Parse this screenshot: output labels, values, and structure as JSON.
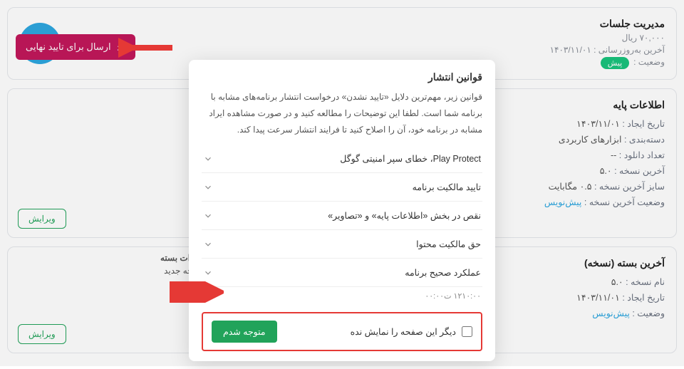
{
  "header": {
    "title": "مدیریت جلسات",
    "price": "۷۰,۰۰۰ ریال",
    "updated_label": "آخرین به‌روزرسانی :",
    "updated_value": "۱۴۰۳/۱۱/۰۱",
    "status_label": "وضعیت :",
    "status_badge": "پیش"
  },
  "submit_label": "ارسال برای تایید نهایی",
  "base_info": {
    "title": "اطلاعات پایه",
    "created_label": "تاریخ ایجاد :",
    "created_value": "۱۴۰۳/۱۱/۰۱",
    "category_label": "دسته‌بندی :",
    "category_value": "ابزارهای کاربردی",
    "downloads_label": "تعداد دانلود :",
    "downloads_value": "--",
    "version_label": "آخرین نسخه :",
    "version_value": "۵.۰",
    "size_label": "سایز آخرین نسخه :",
    "size_value": "۰.۵ مگابایت",
    "vstatus_label": "وضعیت آخرین نسخه :",
    "vstatus_value": "پیش‌نویس",
    "edit": "ویرایش"
  },
  "package": {
    "title": "آخرین بسته (نسخه)",
    "name_label": "نام نسخه :",
    "name_value": "۵.۰",
    "date_label": "تاریخ ایجاد :",
    "date_value": "۱۴۰۳/۱۱/۰۱",
    "status_label": "وضعیت :",
    "status_value": "پیش‌نویس",
    "changes_title": "تغییرات بسته",
    "changes_value": "نسخه جدید",
    "edit": "ویرایش"
  },
  "modal": {
    "title": "قوانین انتشار",
    "desc": "قوانین زیر، مهم‌ترین دلایل «تایید نشدن» درخواست انتشار برنامه‌های مشابه با برنامه شما است. لطفا این توضیحات را مطالعه کنید و در صورت مشاهده ایراد مشابه در برنامه خود، آن را اصلاح کنید تا فرایند انتشار سرعت پیدا کند.",
    "items": [
      "Play Protect، خطای سپر امنیتی گوگل",
      "تایید مالکیت برنامه",
      "نقص در بخش «اطلاعات پایه» و «تصاویر»",
      "حق مالکیت محتوا",
      "عملکرد صحیح برنامه"
    ],
    "counter": "۱۲۱۰:۰۰ ت۰۰:۰۰",
    "dont_show": "دیگر این صفحه را نمایش نده",
    "ok": "متوجه شدم"
  }
}
